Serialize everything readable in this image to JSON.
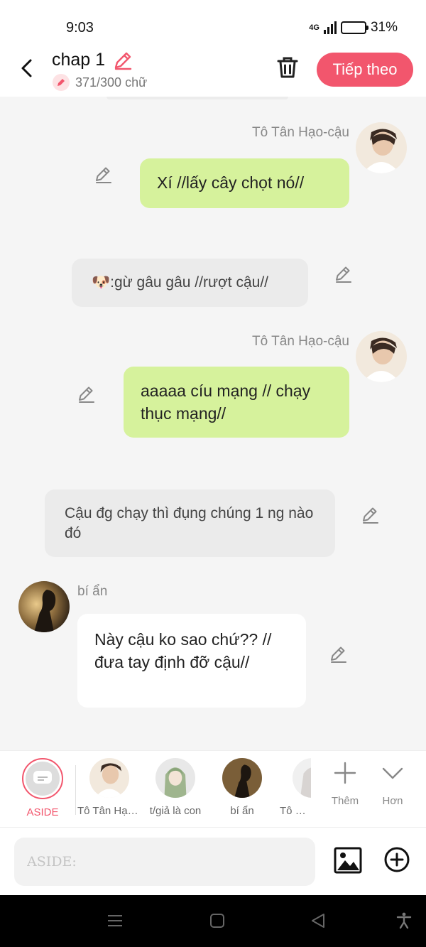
{
  "status": {
    "time": "9:03",
    "network": "4G",
    "battery": "31%",
    "battery_level": 0.31
  },
  "header": {
    "title": "chap 1",
    "word_count": "371/300 chữ",
    "next_label": "Tiếp theo"
  },
  "messages": [
    {
      "type": "right",
      "sender": "Tô Tân Hạo-cậu",
      "text": "Xí //lấy cây chọt nó//"
    },
    {
      "type": "aside",
      "text": "🐶:gừ gâu gâu //rượt cậu//"
    },
    {
      "type": "right",
      "sender": "Tô Tân Hạo-cậu",
      "text": "aaaaa cíu mạng // chạy thục mạng//"
    },
    {
      "type": "aside",
      "text": "Cậu đg chạy thì đụng chúng 1 ng nào đó"
    },
    {
      "type": "left",
      "sender": "bí ẩn",
      "text": "Này cậu ko sao chứ?? //đưa tay định đỡ cậu//"
    }
  ],
  "characters": [
    {
      "name": "ASIDE"
    },
    {
      "name": "Tô Tân Hạo-cậu"
    },
    {
      "name": "t/giả là con"
    },
    {
      "name": "bí ẩn"
    },
    {
      "name": "Tô Ngọc"
    }
  ],
  "tools": {
    "more_label": "Thêm",
    "less_label": "Hơn"
  },
  "input": {
    "placeholder": "ASIDE:"
  },
  "colors": {
    "accent": "#f2566d",
    "bubble_green": "#d6f29c",
    "aside_bg": "#ebebeb"
  }
}
